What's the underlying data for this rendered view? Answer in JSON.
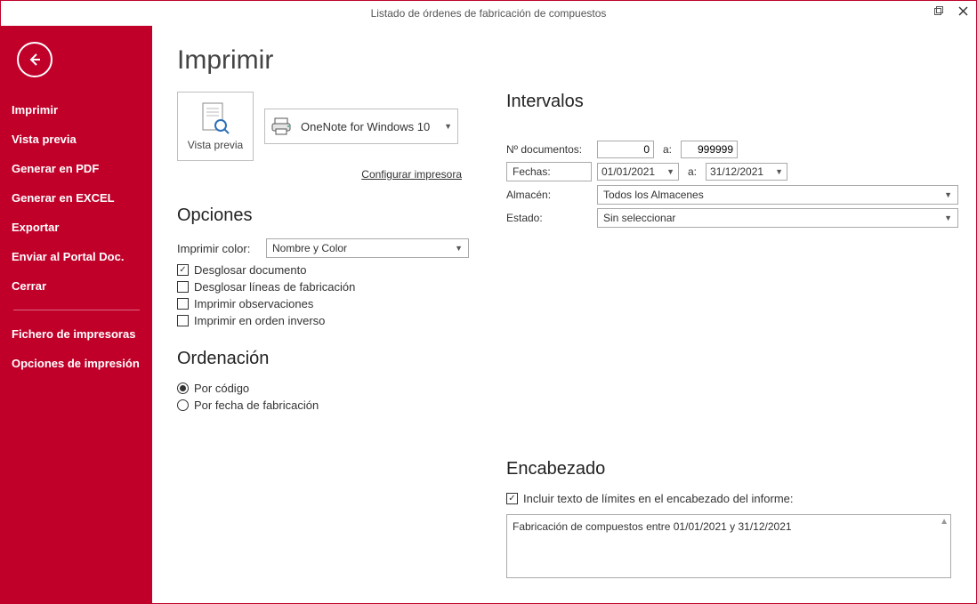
{
  "window": {
    "title": "Listado de órdenes de fabricación de compuestos"
  },
  "sidebar": {
    "items": [
      "Imprimir",
      "Vista previa",
      "Generar en PDF",
      "Generar en EXCEL",
      "Exportar",
      "Enviar al Portal Doc.",
      "Cerrar"
    ],
    "secondary": [
      "Fichero de impresoras",
      "Opciones de impresión"
    ]
  },
  "main": {
    "title": "Imprimir",
    "preview_label": "Vista previa",
    "printer_name": "OneNote for Windows 10",
    "configure_link": "Configurar impresora"
  },
  "options": {
    "heading": "Opciones",
    "color_label": "Imprimir color:",
    "color_value": "Nombre y Color",
    "checks": {
      "desglosar_doc": {
        "label": "Desglosar documento",
        "checked": true
      },
      "desglosar_lineas": {
        "label": "Desglosar líneas de fabricación",
        "checked": false
      },
      "imprimir_obs": {
        "label": "Imprimir observaciones",
        "checked": false
      },
      "orden_inverso": {
        "label": "Imprimir en orden inverso",
        "checked": false
      }
    }
  },
  "ordenacion": {
    "heading": "Ordenación",
    "por_codigo": "Por código",
    "por_fecha": "Por fecha de fabricación",
    "selected": "por_codigo"
  },
  "intervalos": {
    "heading": "Intervalos",
    "ndoc_label": "Nº documentos:",
    "ndoc_from": "0",
    "ndoc_to": "999999",
    "a": "a:",
    "fechas_btn": "Fechas:",
    "fecha_from": "01/01/2021",
    "fecha_to": "31/12/2021",
    "almacen_label": "Almacén:",
    "almacen_value": "Todos los Almacenes",
    "estado_label": "Estado:",
    "estado_value": "Sin seleccionar"
  },
  "encabezado": {
    "heading": "Encabezado",
    "check_label": "Incluir texto de límites en el encabezado del informe:",
    "check_checked": true,
    "text": "Fabricación de compuestos entre 01/01/2021 y 31/12/2021"
  }
}
